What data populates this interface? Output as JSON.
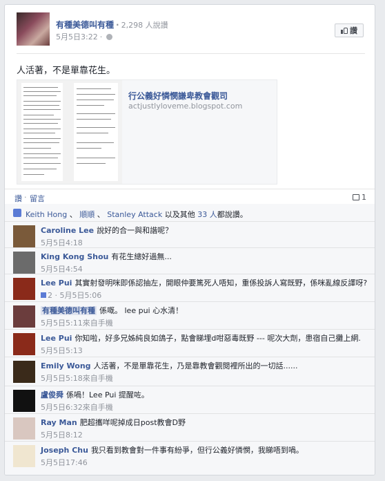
{
  "post": {
    "page_name": "有種美德叫有種",
    "separator": "·",
    "like_count_text": "2,298 人說讚",
    "timestamp": "5月5日3:22",
    "like_button_label": "讚",
    "status_text": "人活著，不是單靠花生。",
    "globe_icon": "globe-icon"
  },
  "link": {
    "title": "行公義好憐憫謙卑教會觀司",
    "url": "actjustlyloveme.blogspot.com"
  },
  "actions": {
    "like_label": "讚",
    "dot": "·",
    "comment_label": "留言",
    "comment_count": "1"
  },
  "likers": {
    "name1": "Keith Hong",
    "sep1": "、",
    "name2": "順順",
    "sep2": "、",
    "name3": "Stanley Attack",
    "and_others": "以及其他",
    "others_count": "33 人",
    "suffix": "都說讚。"
  },
  "comments": [
    {
      "name": "Caroline Lee",
      "text": "說好的合一與和諧呢？",
      "meta": "5月5日4:18",
      "color": "#7a5a3a"
    },
    {
      "name": "King Kong Shou",
      "text": "有花生總好過無...",
      "meta": "5月5日4:54",
      "color": "#6b6b6b"
    },
    {
      "name": "Lee Pui",
      "text": "其實射發明咪即係認抽左，開眼仲要篤死人唔知，重係投訴人寫既野，係咪亂線反譯呀?",
      "meta_likes": "2",
      "meta": "5月5日5:06",
      "color": "#8a2a1a"
    },
    {
      "name": "有種美德叫有種",
      "text": "係嘅。 lee pui 心水清！",
      "meta": "5月5日5:11來自手機",
      "color": "#6b3d3d"
    },
    {
      "name": "Lee Pui",
      "text": "你知啦，好多兄姊純良如鴿子，點會睇埋d咁惡毒既野 --- 呢次大劑，患宿自己攤上網.",
      "meta": "5月5日5:13",
      "color": "#8a2a1a"
    },
    {
      "name": "Emily Wong",
      "text": "人活著，不是單靠花生，乃是靠教會觀閱裡所出的一切話......",
      "meta": "5月5日5:18來自手機",
      "color": "#3a2a1a"
    },
    {
      "name": "盧俊舜",
      "text": "係喎！Lee Pui 提醒咗。",
      "meta": "5月5日6:32來自手機",
      "color": "#111111"
    },
    {
      "name": "Ray Man",
      "text": "肥超攜咩呢掉成日post教會D野",
      "meta": "5月5日8:12",
      "color": "#d9c7c0"
    },
    {
      "name": "Joseph Chu",
      "text": "我只看到教會對一件事有紛爭，但行公義好憐憫，我睇唔到喎。",
      "meta": "5月5日17:46",
      "color": "#f0e6d0"
    }
  ]
}
